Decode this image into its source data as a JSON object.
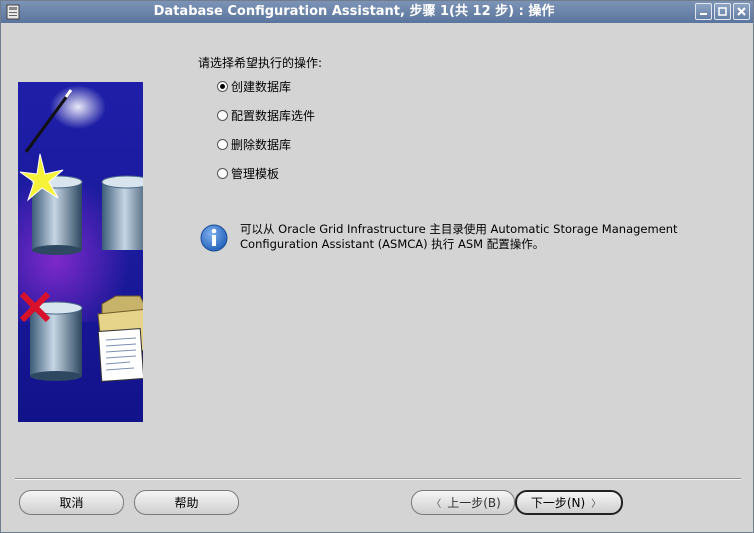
{
  "window": {
    "title": "Database Configuration Assistant, 步骤 1(共 12 步) : 操作"
  },
  "content": {
    "prompt": "请选择希望执行的操作:",
    "options": [
      {
        "label": "创建数据库",
        "selected": true
      },
      {
        "label": "配置数据库选件",
        "selected": false
      },
      {
        "label": "删除数据库",
        "selected": false
      },
      {
        "label": "管理模板",
        "selected": false
      }
    ],
    "info": {
      "icon": "info-icon",
      "line1": "可以从 Oracle Grid Infrastructure 主目录使用 Automatic Storage Management",
      "line2": "Configuration Assistant (ASMCA) 执行 ASM 配置操作。"
    }
  },
  "buttons": {
    "cancel": "取消",
    "help": "帮助",
    "back": "上一步(B)",
    "next": "下一步(N)"
  },
  "colors": {
    "titlebar": "#6a84aa",
    "window_bg": "#d4d4d4",
    "illustration_bg": "#1a1a9c",
    "checkmark": "#c0102a"
  }
}
